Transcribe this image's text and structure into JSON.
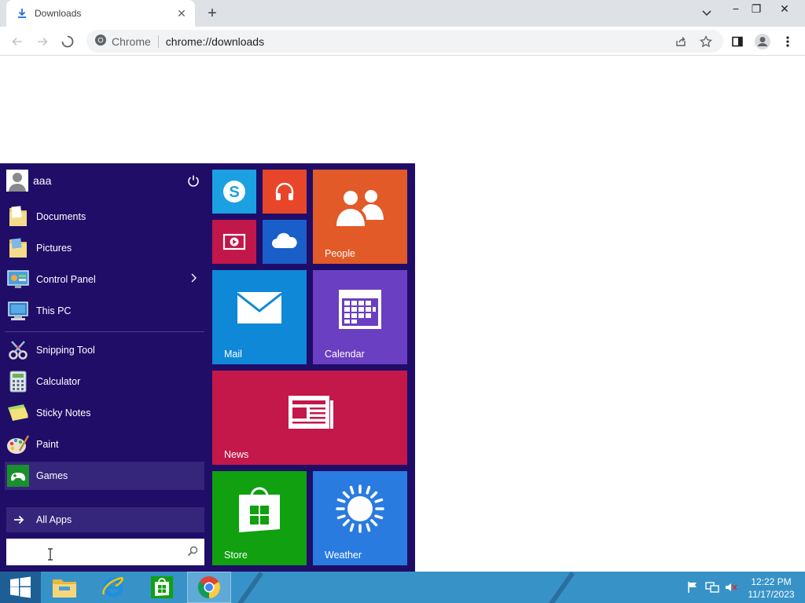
{
  "browser": {
    "tab_title": "Downloads",
    "tab_close": "✕",
    "new_tab": "+",
    "window_controls": [
      "−",
      "❐",
      "✕"
    ],
    "site_name": "Chrome",
    "url": "chrome://downloads"
  },
  "start_menu": {
    "user_name": "aaa",
    "places": [
      {
        "label": "Documents",
        "icon": "folder-icon"
      },
      {
        "label": "Pictures",
        "icon": "folder-icon"
      },
      {
        "label": "Control Panel",
        "icon": "control-panel-icon",
        "has_submenu": true
      },
      {
        "label": "This PC",
        "icon": "computer-icon"
      }
    ],
    "apps": [
      {
        "label": "Snipping Tool",
        "icon": "scissors-icon"
      },
      {
        "label": "Calculator",
        "icon": "calculator-icon"
      },
      {
        "label": "Sticky Notes",
        "icon": "sticky-notes-icon"
      },
      {
        "label": "Paint",
        "icon": "palette-icon"
      },
      {
        "label": "Games",
        "icon": "gamepad-icon",
        "highlighted": true
      }
    ],
    "all_apps": "All Apps",
    "search_value": ""
  },
  "tiles": {
    "people": "People",
    "mail": "Mail",
    "calendar": "Calendar",
    "news": "News",
    "store": "Store",
    "weather": "Weather",
    "colors": {
      "skype": "#1ba1e2",
      "music": "#e8462a",
      "video": "#c1174a",
      "onedrive": "#1a5fc9",
      "people": "#e25a28",
      "mail": "#0f88d8",
      "calendar": "#6a3fc1",
      "news": "#c4174a",
      "store": "#10a010",
      "weather": "#2a7be0"
    }
  },
  "taskbar": {
    "time": "12:22 PM",
    "date": "11/17/2023",
    "color": "#3793c7"
  }
}
